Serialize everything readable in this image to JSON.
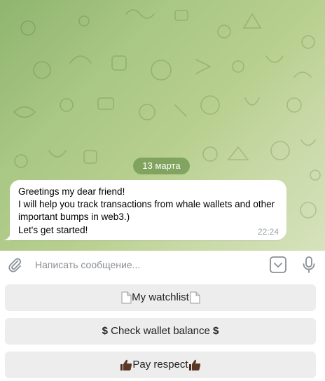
{
  "chat": {
    "date_label": "13 марта",
    "message": {
      "lines": [
        "Greetings my dear friend!",
        "I will help you track transactions from whale wallets and other",
        "important bumps in web3.)",
        "Let's get started!"
      ],
      "time": "22:24"
    }
  },
  "composer": {
    "placeholder": "Написать сообщение...",
    "icons": [
      "paperclip-icon",
      "bot-keyboard-icon",
      "microphone-icon"
    ]
  },
  "keyboard": {
    "buttons": [
      {
        "label": "My watchlist",
        "icon": "page-icon"
      },
      {
        "label": "Check wallet balance",
        "icon": "dollar-sign"
      },
      {
        "label": "Pay respect",
        "icon": "thumbs-up-emoji"
      }
    ]
  },
  "colors": {
    "wallpaper_start": "#8fb56e",
    "wallpaper_end": "#d6e2bc",
    "date_pill": "#6e9650",
    "button_bg": "#ededed",
    "icon_gray": "#8a9096"
  }
}
